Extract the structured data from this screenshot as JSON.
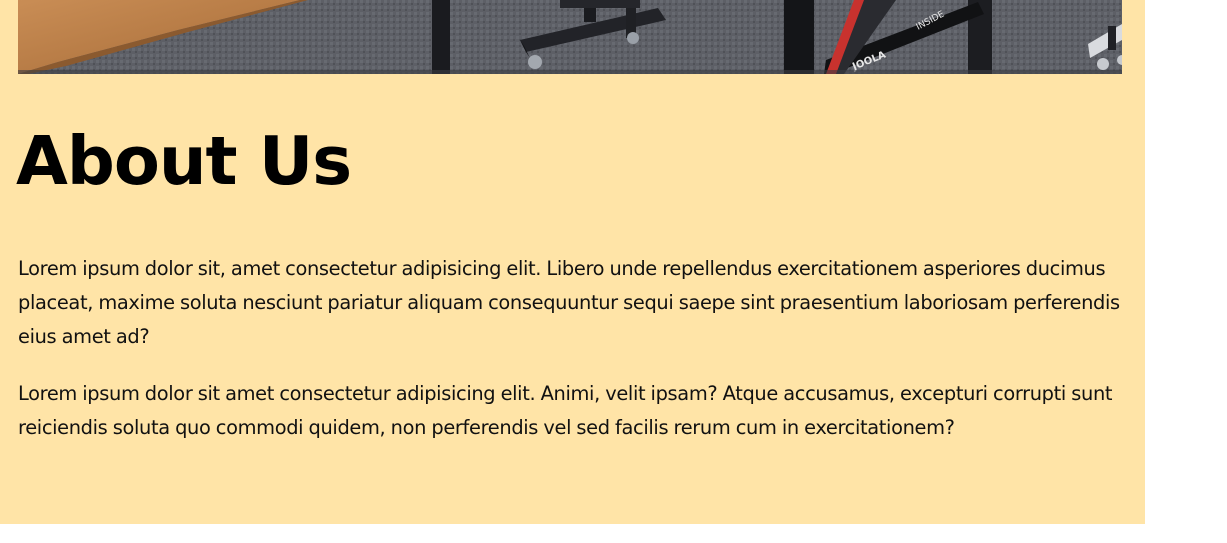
{
  "about": {
    "heading": "About Us",
    "paragraphs": [
      "Lorem ipsum dolor sit, amet consectetur adipisicing elit. Libero unde repellendus exercitationem asperiores ducimus placeat, maxime soluta nesciunt pariatur aliquam consequuntur sequi saepe sint praesentium laboriosam perferendis eius amet ad?",
      "Lorem ipsum dolor sit amet consectetur adipisicing elit. Animi, velit ipsam? Atque accusamus, excepturi corrupti sunt reiciendis soluta quo commodi quidem, non perferendis vel sed facilis rerum cum in exercitationem?"
    ]
  },
  "hero_image": {
    "icon": "ping-pong-table-photo",
    "table_brand_text": "JOOLA",
    "table_side_text": "INSIDE"
  },
  "colors": {
    "section_background": "#ffe4a7",
    "page_background": "#ffffff",
    "heading_text": "#000000",
    "body_text": "#111111"
  }
}
